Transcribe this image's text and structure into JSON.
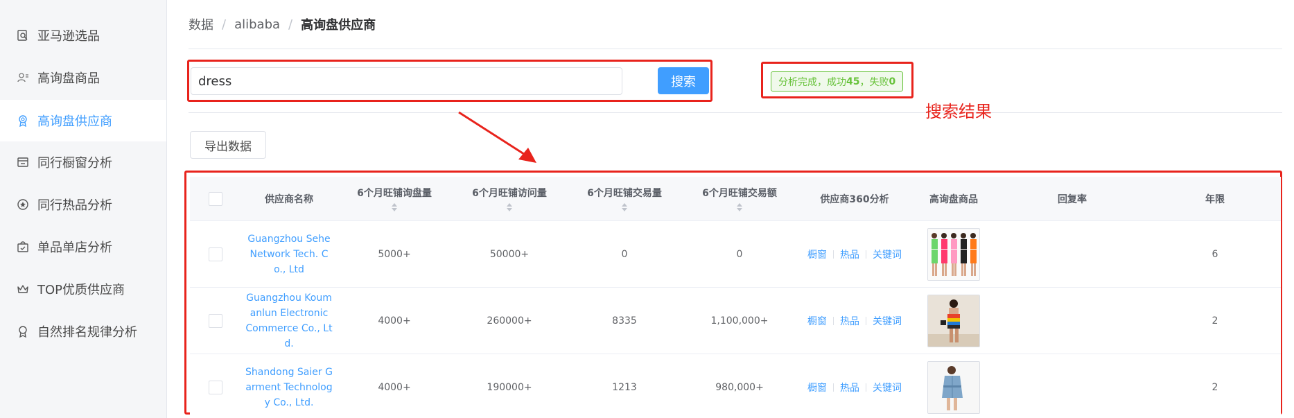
{
  "sidebar": {
    "items": [
      {
        "label": "亚马逊选品",
        "icon": "search-doc-icon",
        "active": false
      },
      {
        "label": "高询盘商品",
        "icon": "user-group-icon",
        "active": false
      },
      {
        "label": "高询盘供应商",
        "icon": "badge-icon",
        "active": true
      },
      {
        "label": "同行橱窗分析",
        "icon": "store-icon",
        "active": false
      },
      {
        "label": "同行热品分析",
        "icon": "star-circle-icon",
        "active": false
      },
      {
        "label": "单品单店分析",
        "icon": "bag-icon",
        "active": false
      },
      {
        "label": "TOP优质供应商",
        "icon": "crown-icon",
        "active": false
      },
      {
        "label": "自然排名规律分析",
        "icon": "medal-icon",
        "active": false
      }
    ]
  },
  "breadcrumb": {
    "items": [
      "数据",
      "alibaba",
      "高询盘供应商"
    ],
    "separator": "/"
  },
  "search": {
    "value": "dress",
    "button_label": "搜索"
  },
  "status": {
    "prefix": "分析完成，成功",
    "success_count": "45",
    "middle": "，失败",
    "fail_count": "0",
    "color": "#67c23a"
  },
  "annotation": {
    "text": "搜索结果",
    "color": "#e8231c"
  },
  "toolbar": {
    "export_label": "导出数据"
  },
  "table": {
    "headers": [
      {
        "label": "供应商名称",
        "sortable": false
      },
      {
        "label": "6个月旺铺询盘量",
        "sortable": true
      },
      {
        "label": "6个月旺铺访问量",
        "sortable": true
      },
      {
        "label": "6个月旺铺交易量",
        "sortable": true
      },
      {
        "label": "6个月旺铺交易额",
        "sortable": true
      },
      {
        "label": "供应商360分析",
        "sortable": false
      },
      {
        "label": "高询盘商品",
        "sortable": false
      },
      {
        "label": "回复率",
        "sortable": false
      },
      {
        "label": "年限",
        "sortable": false
      }
    ],
    "operations": [
      "橱窗",
      "热品",
      "关键词"
    ],
    "rows": [
      {
        "supplier": "Guangzhou Sehe Network Tech. Co., Ltd",
        "inquiries": "5000+",
        "visits": "50000+",
        "transactions": "0",
        "amount": "0",
        "reply_rate": "",
        "years": "6",
        "thumbnail": "product-thumb-group-dresses"
      },
      {
        "supplier": "Guangzhou Koumanlun Electronic Commerce Co., Ltd.",
        "inquiries": "4000+",
        "visits": "260000+",
        "transactions": "8335",
        "amount": "1,100,000+",
        "reply_rate": "",
        "years": "2",
        "thumbnail": "product-thumb-striped-dress"
      },
      {
        "supplier": "Shandong Saier Garment Technology Co., Ltd.",
        "inquiries": "4000+",
        "visits": "190000+",
        "transactions": "1213",
        "amount": "980,000+",
        "reply_rate": "",
        "years": "2",
        "thumbnail": "product-thumb-denim-dress"
      }
    ]
  }
}
